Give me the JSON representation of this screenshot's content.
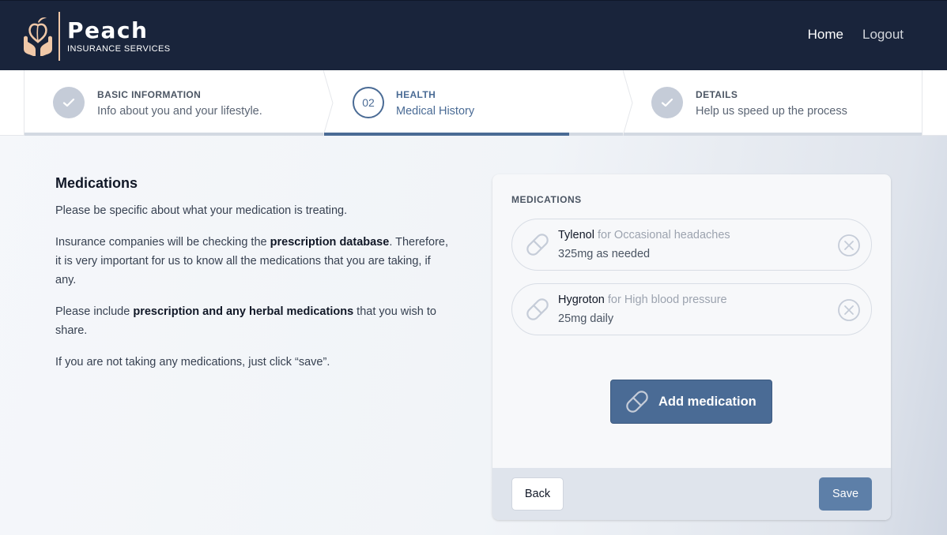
{
  "header": {
    "brand_name": "Peach",
    "brand_subtitle": "INSURANCE SERVICES",
    "nav": {
      "home": "Home",
      "logout": "Logout"
    }
  },
  "stepper": {
    "steps": [
      {
        "status": "complete",
        "title": "BASIC INFORMATION",
        "description": "Info about you and your lifestyle."
      },
      {
        "status": "current",
        "number": "02",
        "title": "HEALTH",
        "description": "Medical History",
        "progress": 0.82
      },
      {
        "status": "complete",
        "title": "DETAILS",
        "description": "Help us speed up the process"
      }
    ]
  },
  "intro": {
    "heading": "Medications",
    "p1": "Please be specific about what your medication is treating.",
    "p2_before": "Insurance companies will be checking the ",
    "p2_bold": "prescription database",
    "p2_after": ". Therefore, it is very important for us to know all the medications that you are taking, if any.",
    "p3_before": "Please include ",
    "p3_bold": "prescription and any herbal medications",
    "p3_after": " that you wish to share.",
    "p4": "If you are not taking any medications, just click “save”."
  },
  "card": {
    "title": "MEDICATIONS",
    "medications": [
      {
        "name": "Tylenol",
        "reason": "for Occasional headaches",
        "dose": "325mg as needed"
      },
      {
        "name": "Hygroton",
        "reason": "for High blood pressure",
        "dose": "25mg daily"
      }
    ],
    "add_label": "Add medication",
    "back_label": "Back",
    "save_label": "Save"
  },
  "colors": {
    "header_bg": "#19243b",
    "accent": "#4a6b95",
    "save_button": "#5d7fa8",
    "footer_bg": "#dfe4ec"
  },
  "icons": [
    "peach-hands-logo",
    "check-icon",
    "pill-icon",
    "remove-circle-x-icon"
  ]
}
